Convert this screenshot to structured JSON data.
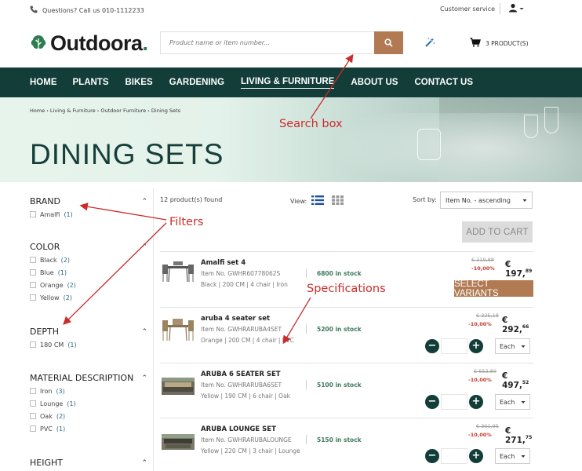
{
  "topbar": {
    "phone_text": "Questions? Call us 010-1112233",
    "customer_service": "Customer service"
  },
  "header": {
    "logo_text": "Outdoora",
    "logo_dot": ".",
    "search_placeholder": "Product name or item number...",
    "cart_label": "3 PRODUCT(S)"
  },
  "nav": {
    "items": [
      "HOME",
      "PLANTS",
      "BIKES",
      "GARDENING",
      "LIVING & FURNITURE",
      "ABOUT US",
      "CONTACT US"
    ],
    "active": "LIVING & FURNITURE"
  },
  "hero": {
    "breadcrumb": "Home › Living & Furniture › Outdoor Furniture › Dining Sets",
    "title": "DINING SETS"
  },
  "filters": [
    {
      "title": "BRAND",
      "options": [
        {
          "label": "Amalfi",
          "count": "(1)"
        }
      ]
    },
    {
      "title": "COLOR",
      "options": [
        {
          "label": "Black",
          "count": "(2)"
        },
        {
          "label": "Blue",
          "count": "(1)"
        },
        {
          "label": "Orange",
          "count": "(2)"
        },
        {
          "label": "Yellow",
          "count": "(2)"
        }
      ]
    },
    {
      "title": "DEPTH",
      "options": [
        {
          "label": "180 CM",
          "count": "(1)"
        }
      ]
    },
    {
      "title": "MATERIAL DESCRIPTION",
      "options": [
        {
          "label": "Iron",
          "count": "(3)"
        },
        {
          "label": "Lounge",
          "count": "(1)"
        },
        {
          "label": "Oak",
          "count": "(2)"
        },
        {
          "label": "PVC",
          "count": "(1)"
        }
      ]
    },
    {
      "title": "HEIGHT",
      "options": []
    }
  ],
  "listing": {
    "found_text": "12 product(s) found",
    "view_label": "View:",
    "sort_label": "Sort by:",
    "sort_value": "Item No. - ascending",
    "add_to_cart": "ADD TO CART"
  },
  "products": [
    {
      "name": "Amalfi set 4",
      "item_no": "Item No. GWHR60778062S",
      "stock": "6800 in stock",
      "specs": "Black | 200 CM | 4 chair | Iron",
      "old_price": "€ 219,88",
      "discount": "-10,00%",
      "price_main": "€ 197,",
      "price_cents": "89",
      "action": "SELECT VARIANTS"
    },
    {
      "name": "aruba 4 seater set",
      "item_no": "Item No. GWHRARUBA4SET",
      "stock": "5200 in stock",
      "specs": "Orange | 200 CM | 4 chair | PVC",
      "old_price": "€ 325,18",
      "discount": "-10,00%",
      "price_main": "€ 292,",
      "price_cents": "66",
      "unit": "Each"
    },
    {
      "name": "ARUBA 6 SEATER SET",
      "item_no": "Item No. GWHRARUBA6SET",
      "stock": "5100 in stock",
      "specs": "Yellow | 190 CM | 6 chair | Oak",
      "old_price": "€ 552,80",
      "discount": "-10,00%",
      "price_main": "€ 497,",
      "price_cents": "52",
      "unit": "Each"
    },
    {
      "name": "ARUBA LOUNGE SET",
      "item_no": "Item No. GWHRARUBALOUNGE",
      "stock": "5150 in stock",
      "specs": "Yellow | 220 CM | 3 chair | Lounge",
      "old_price": "€ 301,95",
      "discount": "-10,00%",
      "price_main": "€ 271,",
      "price_cents": "75",
      "unit": "Each"
    }
  ],
  "annotations": {
    "search_box": "Search box",
    "filters": "Filters",
    "specifications": "Specifications"
  },
  "colors": {
    "brand_dark": "#123d38",
    "accent_brown": "#b17a52",
    "annotation_red": "#cc2b2b",
    "stock_green": "#3d7a5e"
  }
}
